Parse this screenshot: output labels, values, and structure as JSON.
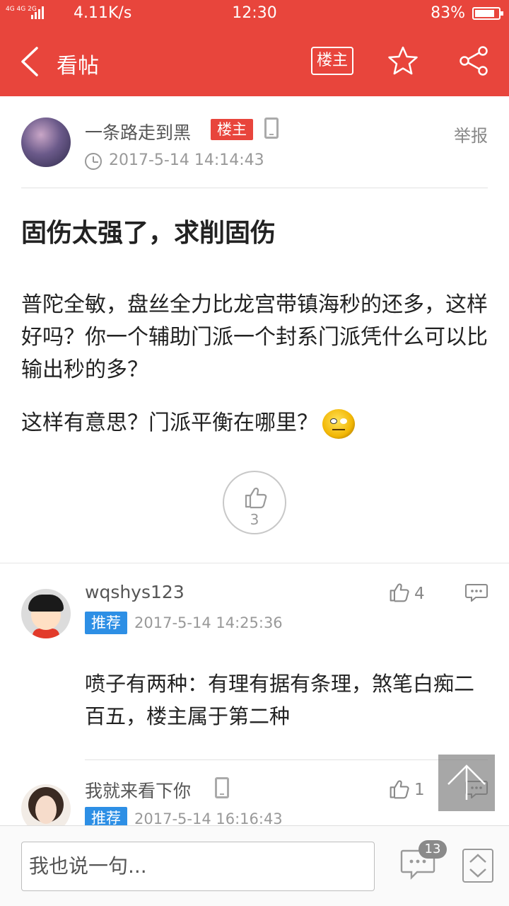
{
  "status_bar": {
    "network": "4G 4G 2G",
    "speed": "4.11K/s",
    "time": "12:30",
    "battery": "83%",
    "battery_level": 0.83
  },
  "app_bar": {
    "title": "看帖",
    "louzhu_button": "楼主",
    "icons": [
      "back-icon",
      "star-icon",
      "share-icon"
    ]
  },
  "post": {
    "author": "一条路走到黑",
    "author_badge": "楼主",
    "report": "举报",
    "time": "2017-5-14 14:14:43",
    "title": "固伤太强了，求削固伤",
    "body": "普陀全敏，盘丝全力比龙宫带镇海秒的还多，这样好吗？你一个辅助门派一个封系门派凭什么可以比输出秒的多？",
    "body2": "这样有意思？门派平衡在哪里？",
    "likes": "3"
  },
  "comments": [
    {
      "author": "wqshys123",
      "badge": "推荐",
      "time": "2017-5-14 14:25:36",
      "likes": "4",
      "body": "喷子有两种：有理有据有条理，煞笔白痴二百五，楼主属于第二种"
    },
    {
      "author": "我就来看下你",
      "badge": "推荐",
      "time": "2017-5-14 16:16:43",
      "likes": "1"
    }
  ],
  "bottom_bar": {
    "input_placeholder": "我也说一句...",
    "comment_count": "13"
  },
  "colors": {
    "brand": "#e8453c",
    "recommend_badge": "#2d8fe5"
  }
}
